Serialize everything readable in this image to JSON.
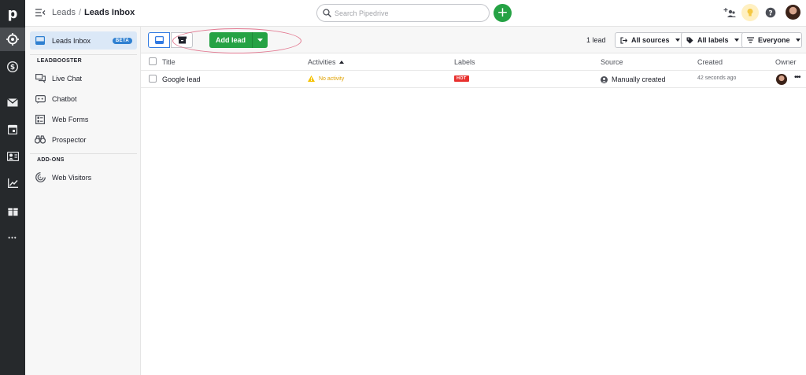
{
  "rail": {
    "logo": "p",
    "items": [
      {
        "icon": "target-icon"
      },
      {
        "icon": "dollar-icon"
      },
      {
        "icon": "mail-icon"
      },
      {
        "icon": "calendar-icon"
      },
      {
        "icon": "contacts-icon"
      },
      {
        "icon": "chart-icon"
      },
      {
        "icon": "marketplace-icon"
      },
      {
        "icon": "more-icon",
        "label": "•••"
      }
    ]
  },
  "header": {
    "breadcrumb_parent": "Leads",
    "breadcrumb_separator": "/",
    "breadcrumb_current": "Leads Inbox",
    "search_placeholder": "Search Pipedrive",
    "add_label": "+"
  },
  "sidebar": {
    "inbox": {
      "label": "Leads Inbox",
      "badge": "BETA"
    },
    "leadbooster_heading": "LEADBOOSTER",
    "leadbooster_items": [
      {
        "label": "Live Chat",
        "icon": "chat-icon"
      },
      {
        "label": "Chatbot",
        "icon": "chatbot-icon"
      },
      {
        "label": "Web Forms",
        "icon": "form-icon"
      },
      {
        "label": "Prospector",
        "icon": "binoculars-icon"
      }
    ],
    "addons_heading": "ADD-ONS",
    "addons_items": [
      {
        "label": "Web Visitors",
        "icon": "radar-icon"
      }
    ]
  },
  "toolbar": {
    "add_lead_label": "Add lead",
    "count": "1 lead",
    "filters": {
      "sources": "All sources",
      "labels": "All labels",
      "owner": "Everyone"
    }
  },
  "table": {
    "columns": [
      "Title",
      "Activities",
      "Labels",
      "Source",
      "Created",
      "Owner"
    ],
    "rows": [
      {
        "title": "Google lead",
        "activities": "No activity",
        "label": "HOT",
        "source": "Manually created",
        "created": "42 seconds ago",
        "more": "•••"
      }
    ]
  },
  "colors": {
    "rail": "#26292c",
    "accent_green": "#25a244",
    "hot_red": "#e8312f",
    "beta_blue": "#2f80d1",
    "warning_yellow": "#e0a100",
    "annotation_oval": "#e2778f"
  }
}
